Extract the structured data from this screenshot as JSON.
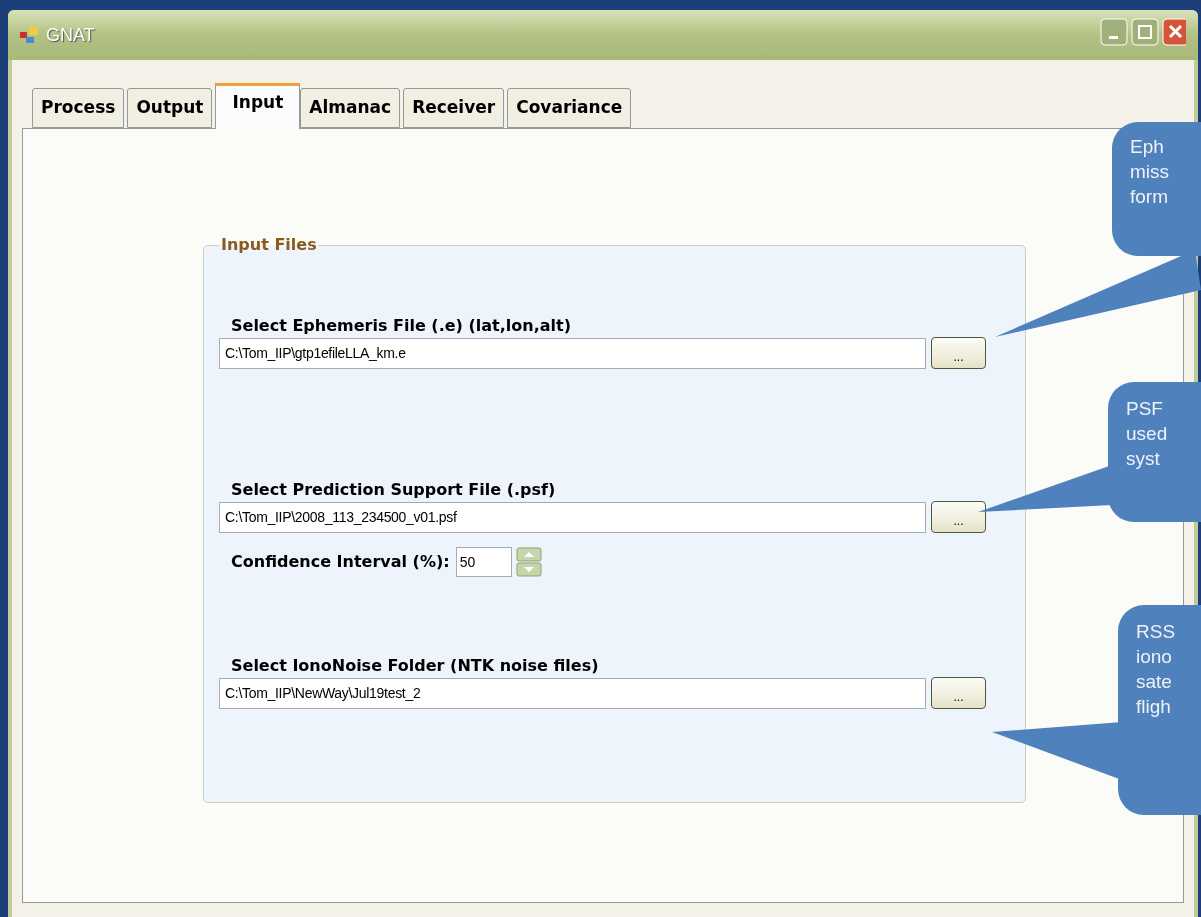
{
  "window": {
    "title": "GNAT"
  },
  "tabs": [
    {
      "label": "Process",
      "selected": false
    },
    {
      "label": "Output",
      "selected": false
    },
    {
      "label": "Input",
      "selected": true
    },
    {
      "label": "Almanac",
      "selected": false
    },
    {
      "label": "Receiver",
      "selected": false
    },
    {
      "label": "Covariance",
      "selected": false
    }
  ],
  "group": {
    "title": "Input Files",
    "rows": [
      {
        "kind": "file",
        "label": "Select Ephemeris File (.e) (lat,lon,alt)",
        "value": "C:\\Tom_IIP\\gtp1efileLLA_km.e",
        "button": "..."
      },
      {
        "kind": "file",
        "label": "Select Prediction Support File (.psf)",
        "value": "C:\\Tom_IIP\\2008_113_234500_v01.psf",
        "button": "..."
      },
      {
        "kind": "spinner",
        "label": "Confidence Interval (%):",
        "value": "50"
      },
      {
        "kind": "file",
        "label": "Select IonoNoise Folder (NTK noise files)",
        "value": "C:\\Tom_IIP\\NewWay\\Jul19test_2",
        "button": "..."
      }
    ]
  },
  "callouts": [
    {
      "lines": [
        "Eph",
        "miss",
        "form"
      ]
    },
    {
      "lines": [
        "PSF",
        "used",
        "syst"
      ]
    },
    {
      "lines": [
        "RSS",
        "iono",
        "sate",
        "fligh"
      ]
    }
  ]
}
